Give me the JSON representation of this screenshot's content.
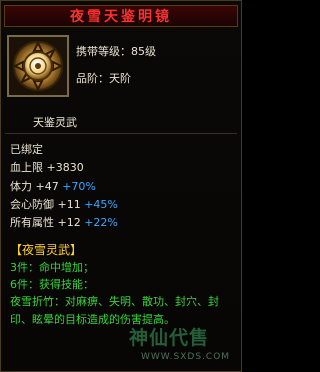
{
  "item": {
    "title": "夜雪天鉴明镜",
    "carry_level": "携带等级：85级",
    "rank": "品阶：天阶",
    "sub_name": "天鉴灵武",
    "icon": "mirror-icon"
  },
  "stats": {
    "bound": "已绑定",
    "hp_label": "血上限",
    "hp_val": "+3830",
    "con_label": "体力",
    "con_val": "+47",
    "con_pct": "+70%",
    "def_label": "会心防御",
    "def_val": "+11",
    "def_pct": "+45%",
    "all_label": "所有属性",
    "all_val": "+12",
    "all_pct": "+22%"
  },
  "set": {
    "title": "【夜雪灵武】",
    "line3": "3件：命中增加；",
    "line6": "6件：获得技能：",
    "skill": "夜雪折竹：对麻痹、失明、散功、封穴、封印、眩晕的目标造成的伤害提高。"
  },
  "watermark": {
    "logo": "神仙代售",
    "url": "WWW.SXDS.COM"
  },
  "colors": {
    "title": "#ff3030",
    "set_title": "#ffd033",
    "set_text": "#38d23a",
    "percent": "#38a7ff"
  }
}
